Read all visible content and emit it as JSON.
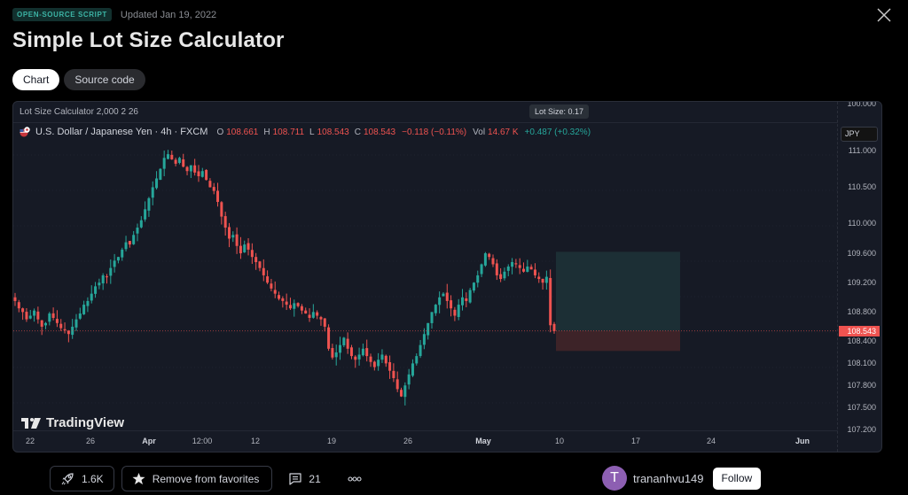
{
  "header": {
    "badge": "OPEN-SOURCE SCRIPT",
    "updated": "Updated Jan 19, 2022",
    "title": "Simple Lot Size Calculator",
    "close_icon": "close-icon"
  },
  "tabs": [
    {
      "label": "Chart",
      "active": true
    },
    {
      "label": "Source code",
      "active": false
    }
  ],
  "chart": {
    "indicator_line": "Lot Size Calculator 2,000 2 26",
    "lot_tooltip": "Lot Size: 0.17",
    "symbol": "U.S. Dollar / Japanese Yen · 4h · FXCM",
    "ohlc": {
      "o_label": "O",
      "o": "108.661",
      "h_label": "H",
      "h": "108.711",
      "l_label": "L",
      "l": "108.543",
      "c_label": "C",
      "c": "108.543",
      "change": "−0.118 (−0.11%)",
      "vol_label": "Vol",
      "vol": "14.67 K",
      "vol_change": "+0.487 (+0.32%)"
    },
    "currency_button": "JPY",
    "current_price": "108.543",
    "price_ticks": [
      "100.000",
      "111.000",
      "110.500",
      "110.000",
      "109.600",
      "109.200",
      "108.800",
      "108.400",
      "108.100",
      "107.800",
      "107.500",
      "107.200"
    ],
    "time_ticks": [
      {
        "label": "22",
        "bold": false
      },
      {
        "label": "26",
        "bold": false
      },
      {
        "label": "Apr",
        "bold": true
      },
      {
        "label": "12:00",
        "bold": false
      },
      {
        "label": "12",
        "bold": false
      },
      {
        "label": "19",
        "bold": false
      },
      {
        "label": "26",
        "bold": false
      },
      {
        "label": "May",
        "bold": true
      },
      {
        "label": "10",
        "bold": false
      },
      {
        "label": "17",
        "bold": false
      },
      {
        "label": "24",
        "bold": false
      },
      {
        "label": "Jun",
        "bold": true
      }
    ],
    "brand": "TradingView",
    "colors": {
      "up": "#26a69a",
      "down": "#ef5350",
      "background": "#161a25"
    }
  },
  "chart_data": {
    "type": "candlestick",
    "title": "U.S. Dollar / Japanese Yen · 4h · FXCM",
    "ylim": [
      107.15,
      111.35
    ],
    "current_price": 108.543,
    "position_tool": {
      "entry": 108.543,
      "target": 109.62,
      "stop": 108.27
    },
    "close_path": [
      108.95,
      108.85,
      108.8,
      108.7,
      108.75,
      108.82,
      108.7,
      108.6,
      108.65,
      108.78,
      108.72,
      108.65,
      108.58,
      108.55,
      108.5,
      108.6,
      108.7,
      108.78,
      108.9,
      108.95,
      109.05,
      109.15,
      109.2,
      109.3,
      109.28,
      109.4,
      109.5,
      109.55,
      109.65,
      109.75,
      109.72,
      109.85,
      109.95,
      110.05,
      110.2,
      110.35,
      110.5,
      110.62,
      110.75,
      110.9,
      110.95,
      110.88,
      110.82,
      110.9,
      110.78,
      110.72,
      110.8,
      110.7,
      110.65,
      110.72,
      110.6,
      110.5,
      110.45,
      110.3,
      110.1,
      109.95,
      109.8,
      109.85,
      109.7,
      109.6,
      109.72,
      109.65,
      109.55,
      109.48,
      109.4,
      109.3,
      109.2,
      109.12,
      109.05,
      108.98,
      108.95,
      108.9,
      108.85,
      108.92,
      108.88,
      108.82,
      108.78,
      108.72,
      108.8,
      108.75,
      108.7,
      108.6,
      108.3,
      108.18,
      108.25,
      108.35,
      108.45,
      108.3,
      108.2,
      108.15,
      108.22,
      108.3,
      108.2,
      108.12,
      108.05,
      108.15,
      108.22,
      108.1,
      108.0,
      107.9,
      107.75,
      107.65,
      107.8,
      107.95,
      108.1,
      108.2,
      108.35,
      108.5,
      108.65,
      108.8,
      108.9,
      109.0,
      109.05,
      108.95,
      108.85,
      108.75,
      108.9,
      109.0,
      108.95,
      109.1,
      109.2,
      109.3,
      109.45,
      109.6,
      109.55,
      109.45,
      109.3,
      109.25,
      109.35,
      109.42,
      109.48,
      109.45,
      109.4,
      109.35,
      109.42,
      109.38,
      109.3,
      109.25,
      109.2,
      109.28,
      108.62,
      108.54
    ]
  },
  "actions": {
    "boosts": "1.6K",
    "favorites": "Remove from favorites",
    "comments": "21",
    "more": "ooo"
  },
  "author": {
    "initial": "T",
    "name": "trananhvu149",
    "follow": "Follow"
  }
}
